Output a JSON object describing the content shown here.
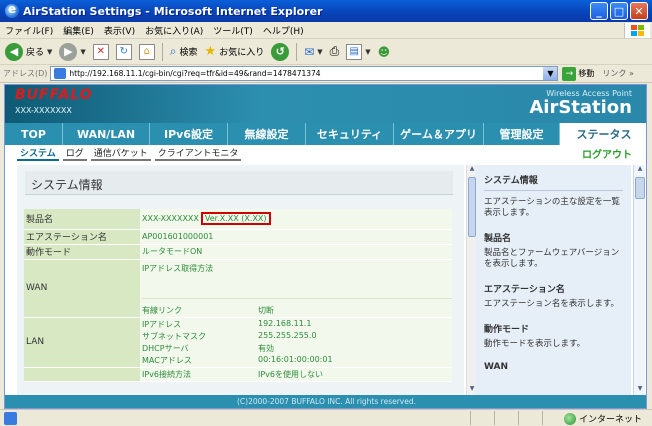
{
  "window": {
    "title": "AirStation Settings - Microsoft Internet Explorer"
  },
  "menu": [
    "ファイル(F)",
    "編集(E)",
    "表示(V)",
    "お気に入り(A)",
    "ツール(T)",
    "ヘルプ(H)"
  ],
  "toolbar": {
    "back": "戻る",
    "search": "検索",
    "favorites": "お気に入り"
  },
  "address": {
    "label": "アドレス(D)",
    "url": "http://192.168.11.1/cgi-bin/cgi?req=tfr&id=49&rand=1478471374",
    "go": "移動",
    "links": "リンク"
  },
  "page": {
    "brand": "BUFFALO",
    "model": "XXX-XXXXXXX",
    "wap": "Wireless Access Point",
    "product": "AirStation",
    "nav": [
      "TOP",
      "WAN/LAN",
      "IPv6設定",
      "無線設定",
      "セキュリティ",
      "ゲーム＆アプリ",
      "管理設定",
      "ステータス"
    ],
    "subnav": [
      "システム",
      "ログ",
      "通信パケット",
      "クライアントモニタ"
    ],
    "logout": "ログアウト",
    "section_title": "システム情報",
    "rows": {
      "product_label": "製品名",
      "product_value": "XXX-XXXXXXX",
      "product_version": "Ver.X.XX (X.XX)",
      "station_label": "エアステーション名",
      "station_value": "AP001601000001",
      "mode_label": "動作モード",
      "mode_value": "ルータモードON",
      "wan_label": "WAN",
      "wan_method": "IPアドレス取得方法",
      "wan_link_label": "有線リンク",
      "wan_link_value": "切断",
      "lan_label": "LAN",
      "lan_ip_label": "IPアドレス",
      "lan_ip_value": "192.168.11.1",
      "lan_mask_label": "サブネットマスク",
      "lan_mask_value": "255.255.255.0",
      "lan_dhcp_label": "DHCPサーバ",
      "lan_dhcp_value": "有効",
      "lan_mac_label": "MACアドレス",
      "lan_mac_value": "00:16:01:00:00:01",
      "ipv6_label": "IPv6接続方法",
      "ipv6_value": "IPv6を使用しない"
    },
    "copyright": "(C)2000-2007 BUFFALO INC. All rights reserved.",
    "help": [
      {
        "title": "システム情報",
        "body": "エアステーションの主な設定を一覧表示します。"
      },
      {
        "title": "製品名",
        "body": "製品名とファームウェアバージョンを表示します。"
      },
      {
        "title": "エアステーション名",
        "body": "エアステーション名を表示します。"
      },
      {
        "title": "動作モード",
        "body": "動作モードを表示します。"
      },
      {
        "title": "WAN",
        "body": ""
      }
    ]
  },
  "status": {
    "zone": "インターネット"
  }
}
